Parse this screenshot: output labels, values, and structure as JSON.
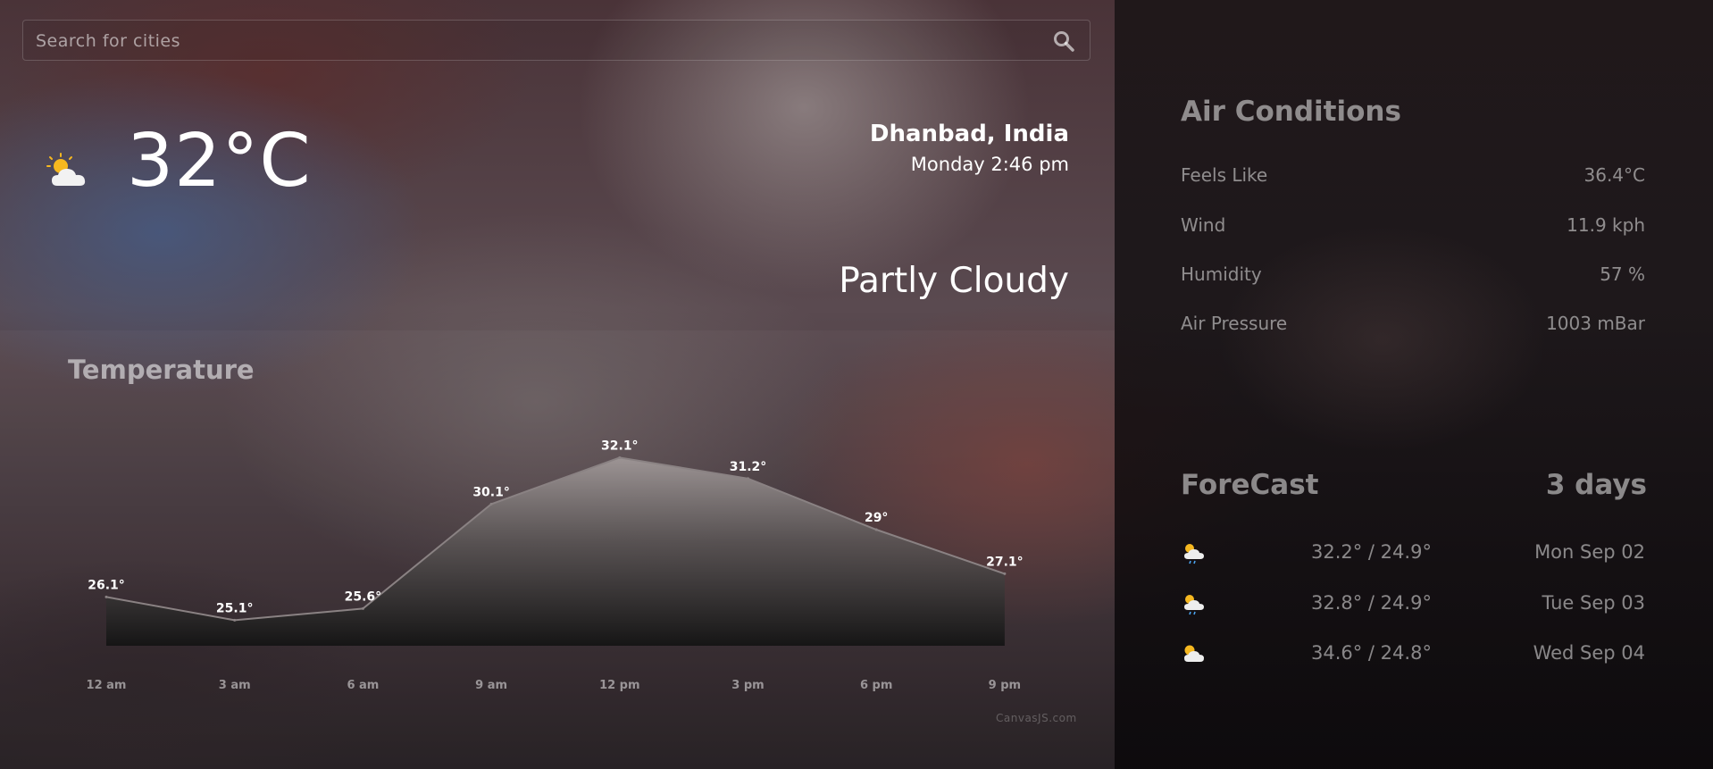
{
  "search": {
    "placeholder": "Search for cities",
    "icon": "search-icon"
  },
  "current": {
    "temperature": "32°C",
    "icon": "partly-cloudy-icon",
    "city": "Dhanbad, India",
    "datetime": "Monday 2:46 pm",
    "condition": "Partly Cloudy"
  },
  "temperature_chart": {
    "title": "Temperature",
    "credit": "CanvasJS.com"
  },
  "chart_data": {
    "type": "area",
    "title": "Temperature",
    "categories": [
      "12 am",
      "3 am",
      "6 am",
      "9 am",
      "12 pm",
      "3 pm",
      "6 pm",
      "9 pm"
    ],
    "values": [
      26.1,
      25.1,
      25.6,
      30.1,
      32.1,
      31.2,
      29,
      27.1
    ],
    "labels": [
      "26.1°",
      "25.1°",
      "25.6°",
      "30.1°",
      "32.1°",
      "31.2°",
      "29°",
      "27.1°"
    ],
    "ylim": [
      24,
      33.5
    ],
    "grid": false,
    "colors": {
      "fill_top": "#a09898",
      "fill_bottom": "#141414",
      "line": "#8a8283"
    }
  },
  "air_conditions": {
    "title": "Air Conditions",
    "rows": [
      {
        "label": "Feels Like",
        "value": "36.4°C"
      },
      {
        "label": "Wind",
        "value": "11.9 kph"
      },
      {
        "label": "Humidity",
        "value": "57 %"
      },
      {
        "label": "Air Pressure",
        "value": "1003 mBar"
      }
    ]
  },
  "forecast": {
    "title": "ForeCast",
    "days_label": "3 days",
    "rows": [
      {
        "icon": "cloud-sun-rain-icon",
        "temps": "32.2° / 24.9°",
        "day": "Mon Sep 02"
      },
      {
        "icon": "cloud-sun-rain-icon",
        "temps": "32.8° / 24.9°",
        "day": "Tue Sep 03"
      },
      {
        "icon": "partly-cloudy-icon",
        "temps": "34.6° / 24.8°",
        "day": "Wed Sep 04"
      }
    ]
  }
}
